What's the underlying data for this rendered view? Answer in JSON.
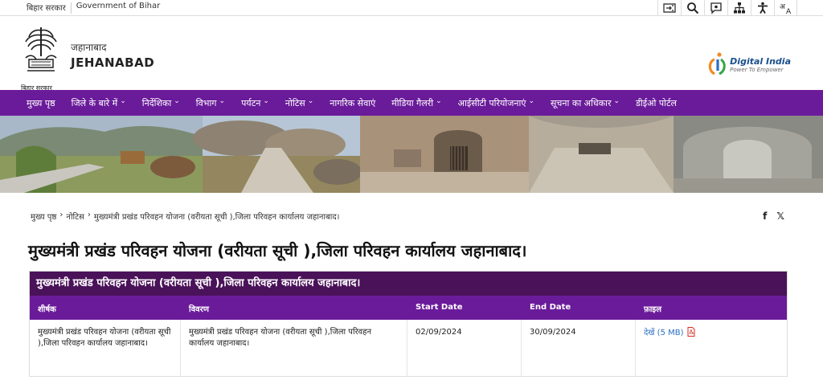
{
  "topbar": {
    "bihar_sarkar": "बिहार सरकार",
    "gov_of_bihar": "Government of Bihar",
    "tools": [
      "skip-to-content-icon",
      "search-icon",
      "social-media-icon",
      "sitemap-icon",
      "accessibility-icon",
      "language-icon"
    ]
  },
  "header": {
    "emblem_caption": "बिहार सरकार",
    "district_hi": "जहानाबाद",
    "district_en": "JEHANABAD",
    "digital_india_title": "Digital India",
    "digital_india_tagline": "Power To Empower"
  },
  "nav": {
    "items": [
      {
        "label": "मुख्य पृष्ठ",
        "has_dropdown": false
      },
      {
        "label": "जिले के बारे में",
        "has_dropdown": true
      },
      {
        "label": "निर्देशिका",
        "has_dropdown": true
      },
      {
        "label": "विभाग",
        "has_dropdown": true
      },
      {
        "label": "पर्यटन",
        "has_dropdown": true
      },
      {
        "label": "नोटिस",
        "has_dropdown": true
      },
      {
        "label": "नागरिक सेवाएं",
        "has_dropdown": false
      },
      {
        "label": "मीडिया गैलरी",
        "has_dropdown": true
      },
      {
        "label": "आईसीटी परियोजनाएं",
        "has_dropdown": true
      },
      {
        "label": "सूचना का अधिकार",
        "has_dropdown": true
      },
      {
        "label": "डीईओ पोर्टल",
        "has_dropdown": false
      }
    ],
    "color": "#6a1b9a"
  },
  "breadcrumb": {
    "items": [
      "मुख्य पृष्ठ",
      "नोटिस",
      "मुख्यमंत्री प्रखंड परिवहन योजना (वरीयता सूची ),जिला परिवहन कार्यालय जहानाबाद।"
    ],
    "separator": "›"
  },
  "share": {
    "facebook": "f",
    "x": "𝕏"
  },
  "page_title": "मुख्यमंत्री प्रखंड परिवहन योजना (वरीयता सूची ),जिला परिवहन कार्यालय जहानाबाद।",
  "table": {
    "caption": "मुख्यमंत्री प्रखंड परिवहन योजना (वरीयता सूची ),जिला परिवहन कार्यालय जहानाबाद।",
    "headers": [
      "शीर्षक",
      "विवरण",
      "Start Date",
      "End Date",
      "फ़ाइल"
    ],
    "rows": [
      {
        "title": "मुख्यमंत्री प्रखंड परिवहन योजना (वरीयता सूची ),जिला परिवहन कार्यालय जहानाबाद।",
        "description": "मुख्यमंत्री प्रखंड परिवहन योजना (वरीयता सूची ),जिला परिवहन कार्यालय जहानाबाद।",
        "start_date": "02/09/2024",
        "end_date": "30/09/2024",
        "file_link": "देखें (5 MB)"
      }
    ],
    "caption_color": "#4a1259",
    "header_color": "#6a1b9a"
  }
}
